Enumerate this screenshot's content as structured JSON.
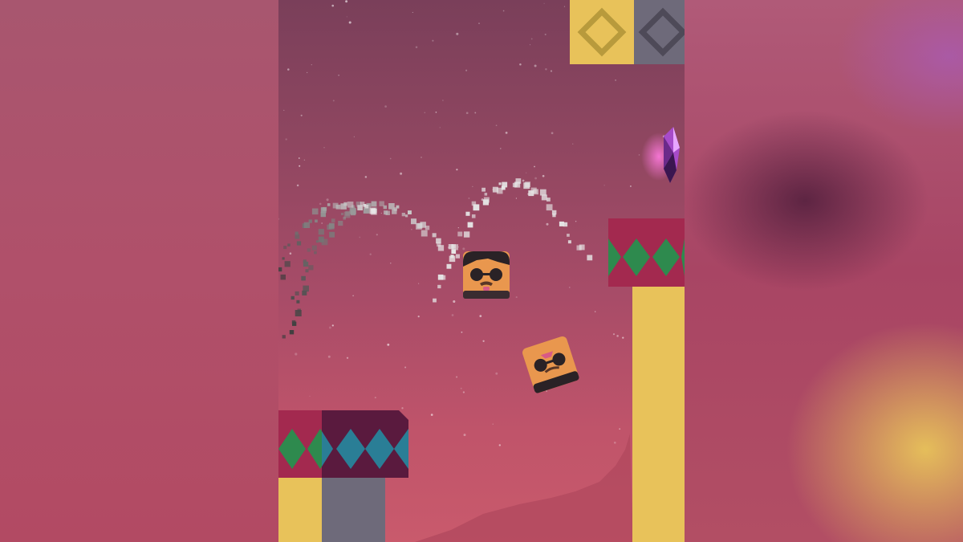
{
  "scene": {
    "type": "vertical-jump-platformer",
    "player": {
      "icon": "blocky-character-sunglasses-mustache"
    },
    "companion": {
      "icon": "blocky-character-sunglasses-rotated"
    },
    "pickup": {
      "icon": "purple-crystal-gem-icon"
    },
    "colors": {
      "sky_top": "#7a3f5a",
      "sky_bottom": "#c95a6c",
      "pillar_yellow": "#e8c25a",
      "pillar_gray": "#6e6a7a",
      "band_crimson": "#a3294f",
      "band_dark": "#5a1a3e",
      "diamond_green": "#2e8a4e",
      "diamond_teal": "#2a7e96"
    }
  }
}
